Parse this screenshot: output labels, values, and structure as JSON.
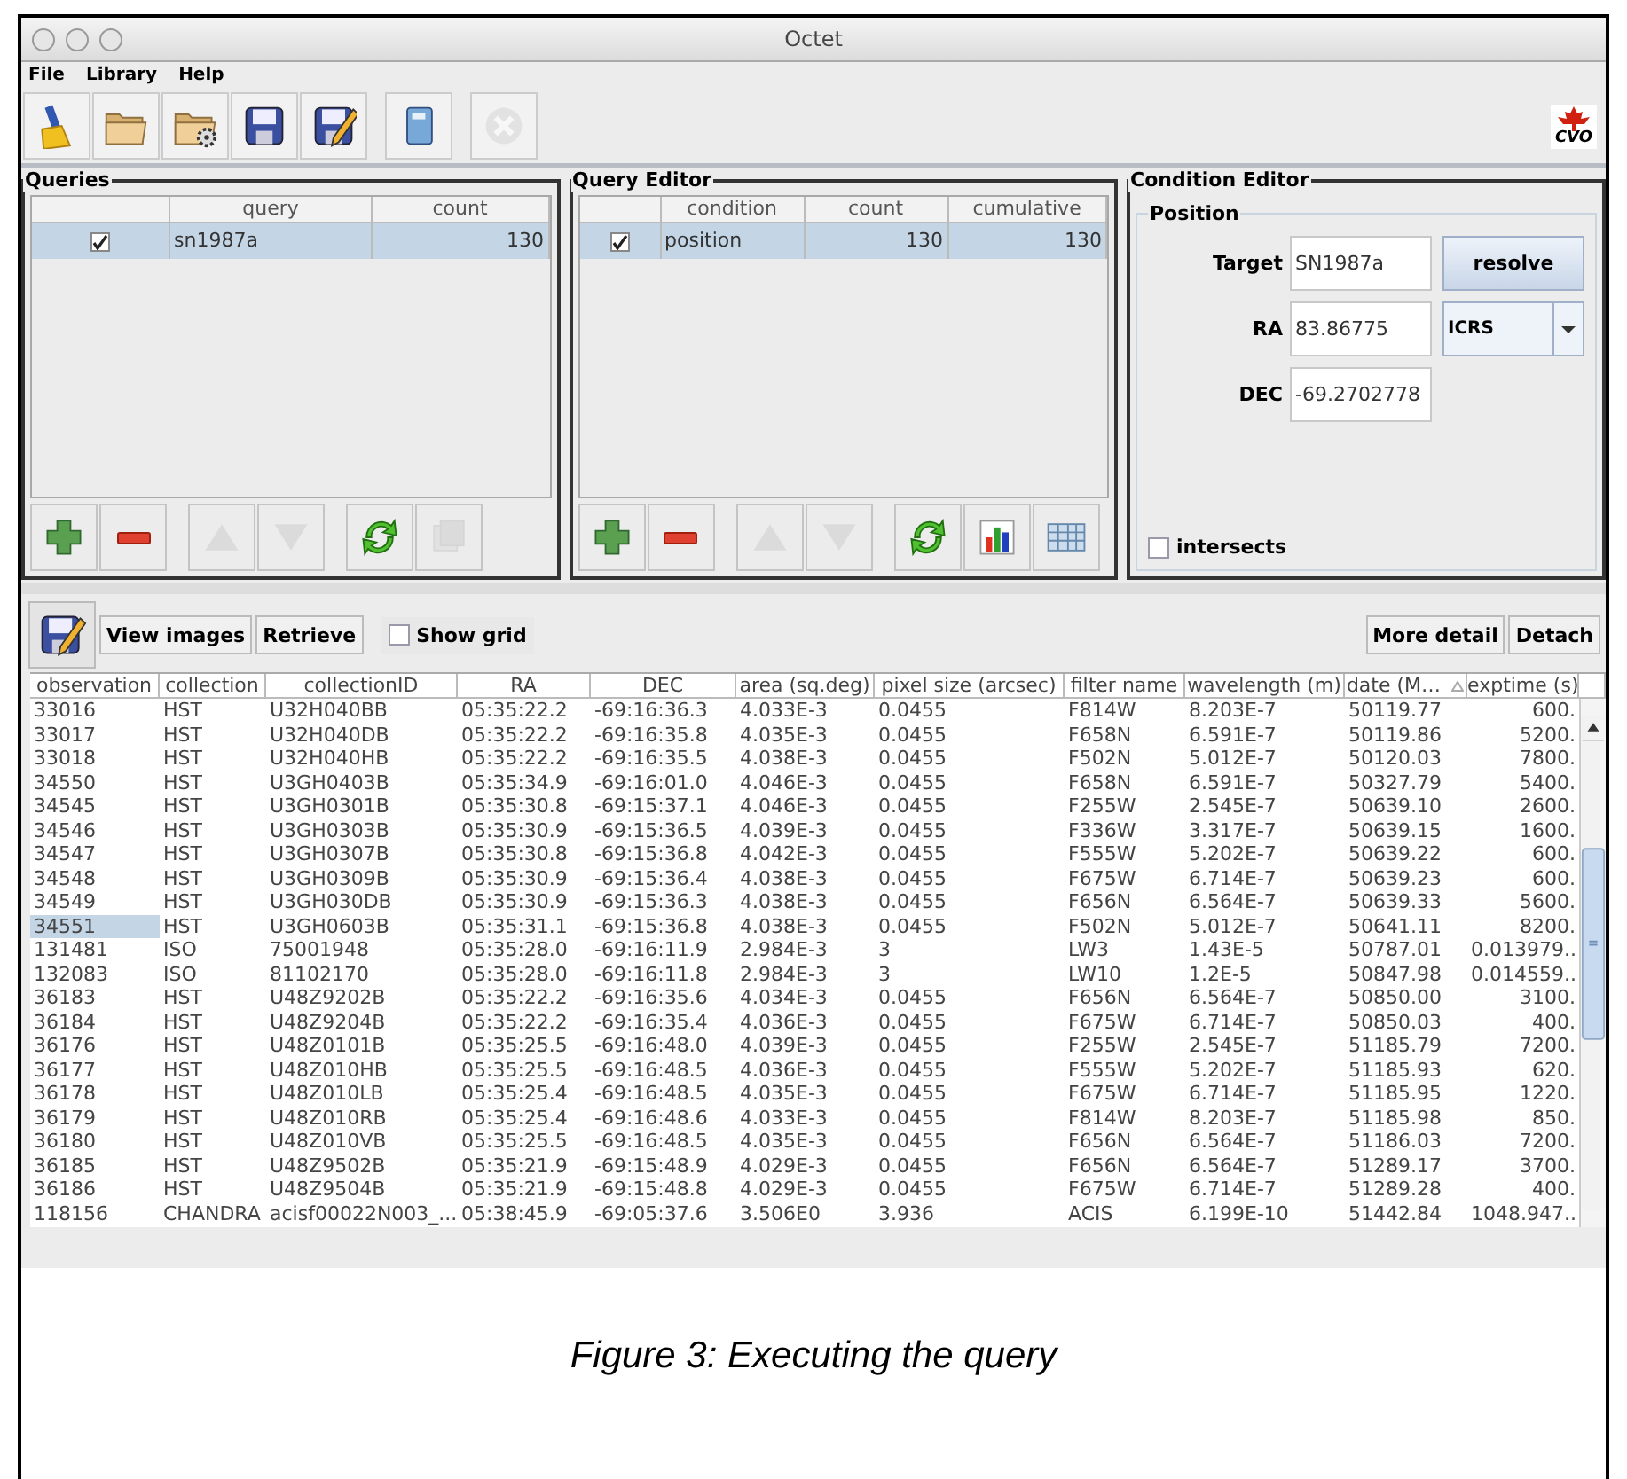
{
  "window": {
    "title": "Octet",
    "menu": [
      "File",
      "Library",
      "Help"
    ],
    "toolbar": [
      {
        "kind": "broom",
        "disabled": false
      },
      {
        "kind": "folder",
        "disabled": false
      },
      {
        "kind": "folder-gear",
        "disabled": false
      },
      {
        "kind": "floppy",
        "disabled": false
      },
      {
        "kind": "floppy-edit",
        "disabled": false
      },
      {
        "kind": "book",
        "disabled": false
      },
      {
        "kind": "cancel",
        "disabled": true
      }
    ],
    "logo_text": "CVO"
  },
  "queries": {
    "title": "Queries",
    "columns": [
      "",
      "query",
      "count"
    ],
    "rows": [
      {
        "checked": true,
        "query": "sn1987a",
        "count": "130",
        "selected": true
      }
    ],
    "buttons": [
      {
        "kind": "plus",
        "disabled": false
      },
      {
        "kind": "minus",
        "disabled": false
      },
      {
        "kind": "up",
        "disabled": true
      },
      {
        "kind": "down",
        "disabled": true
      },
      {
        "kind": "refresh",
        "disabled": false
      },
      {
        "kind": "copy",
        "disabled": true
      }
    ]
  },
  "query_editor": {
    "title": "Query Editor",
    "columns": [
      "",
      "condition",
      "count",
      "cumulative"
    ],
    "rows": [
      {
        "checked": true,
        "condition": "position",
        "count": "130",
        "cumulative": "130",
        "selected": true
      }
    ],
    "buttons": [
      {
        "kind": "plus",
        "disabled": false
      },
      {
        "kind": "minus",
        "disabled": false
      },
      {
        "kind": "up",
        "disabled": true
      },
      {
        "kind": "down",
        "disabled": true
      },
      {
        "kind": "refresh",
        "disabled": false
      },
      {
        "kind": "chart",
        "disabled": false
      },
      {
        "kind": "grid",
        "disabled": false
      }
    ]
  },
  "condition_editor": {
    "title": "Condition Editor",
    "group": "Position",
    "fields": [
      {
        "label": "Target",
        "value": "SN1987a"
      },
      {
        "label": "RA",
        "value": "83.86775"
      },
      {
        "label": "DEC",
        "value": "-69.2702778"
      }
    ],
    "resolve_button": "resolve",
    "frame": "ICRS",
    "intersects": {
      "label": "intersects",
      "checked": false
    }
  },
  "results": {
    "buttons": [
      "View images",
      "Retrieve"
    ],
    "show_grid": {
      "label": "Show grid",
      "checked": false
    },
    "right_buttons": [
      "More detail",
      "Detach"
    ],
    "columns": [
      "observation",
      "collection",
      "collectionID",
      "RA",
      "DEC",
      "area (sq.deg)",
      "pixel size (arcsec)",
      "filter name",
      "wavelength (m)",
      "date (M…",
      "exptime (s)"
    ],
    "rows": [
      {
        "selected": false,
        "cells": [
          "33016",
          "HST",
          "U32H040BB",
          "05:35:22.2",
          "-69:16:36.3",
          "4.033E-3",
          "0.0455",
          "F814W",
          "8.203E-7",
          "50119.77",
          "600."
        ]
      },
      {
        "selected": false,
        "cells": [
          "33017",
          "HST",
          "U32H040DB",
          "05:35:22.2",
          "-69:16:35.8",
          "4.035E-3",
          "0.0455",
          "F658N",
          "6.591E-7",
          "50119.86",
          "5200."
        ]
      },
      {
        "selected": false,
        "cells": [
          "33018",
          "HST",
          "U32H040HB",
          "05:35:22.2",
          "-69:16:35.5",
          "4.038E-3",
          "0.0455",
          "F502N",
          "5.012E-7",
          "50120.03",
          "7800."
        ]
      },
      {
        "selected": false,
        "cells": [
          "34550",
          "HST",
          "U3GH0403B",
          "05:35:34.9",
          "-69:16:01.0",
          "4.046E-3",
          "0.0455",
          "F658N",
          "6.591E-7",
          "50327.79",
          "5400."
        ]
      },
      {
        "selected": false,
        "cells": [
          "34545",
          "HST",
          "U3GH0301B",
          "05:35:30.8",
          "-69:15:37.1",
          "4.046E-3",
          "0.0455",
          "F255W",
          "2.545E-7",
          "50639.10",
          "2600."
        ]
      },
      {
        "selected": false,
        "cells": [
          "34546",
          "HST",
          "U3GH0303B",
          "05:35:30.9",
          "-69:15:36.5",
          "4.039E-3",
          "0.0455",
          "F336W",
          "3.317E-7",
          "50639.15",
          "1600."
        ]
      },
      {
        "selected": false,
        "cells": [
          "34547",
          "HST",
          "U3GH0307B",
          "05:35:30.8",
          "-69:15:36.8",
          "4.042E-3",
          "0.0455",
          "F555W",
          "5.202E-7",
          "50639.22",
          "600."
        ]
      },
      {
        "selected": false,
        "cells": [
          "34548",
          "HST",
          "U3GH0309B",
          "05:35:30.9",
          "-69:15:36.4",
          "4.038E-3",
          "0.0455",
          "F675W",
          "6.714E-7",
          "50639.23",
          "600."
        ]
      },
      {
        "selected": false,
        "cells": [
          "34549",
          "HST",
          "U3GH030DB",
          "05:35:30.9",
          "-69:15:36.3",
          "4.038E-3",
          "0.0455",
          "F656N",
          "6.564E-7",
          "50639.33",
          "5600."
        ]
      },
      {
        "selected": true,
        "cells": [
          "34551",
          "HST",
          "U3GH0603B",
          "05:35:31.1",
          "-69:15:36.8",
          "4.038E-3",
          "0.0455",
          "F502N",
          "5.012E-7",
          "50641.11",
          "8200."
        ]
      },
      {
        "selected": false,
        "cells": [
          "131481",
          "ISO",
          "75001948",
          "05:35:28.0",
          "-69:16:11.9",
          "2.984E-3",
          "3",
          "LW3",
          "1.43E-5",
          "50787.01",
          "0.013979.."
        ]
      },
      {
        "selected": false,
        "cells": [
          "132083",
          "ISO",
          "81102170",
          "05:35:28.0",
          "-69:16:11.8",
          "2.984E-3",
          "3",
          "LW10",
          "1.2E-5",
          "50847.98",
          "0.014559.."
        ]
      },
      {
        "selected": false,
        "cells": [
          "36183",
          "HST",
          "U48Z9202B",
          "05:35:22.2",
          "-69:16:35.6",
          "4.034E-3",
          "0.0455",
          "F656N",
          "6.564E-7",
          "50850.00",
          "3100."
        ]
      },
      {
        "selected": false,
        "cells": [
          "36184",
          "HST",
          "U48Z9204B",
          "05:35:22.2",
          "-69:16:35.4",
          "4.036E-3",
          "0.0455",
          "F675W",
          "6.714E-7",
          "50850.03",
          "400."
        ]
      },
      {
        "selected": false,
        "cells": [
          "36176",
          "HST",
          "U48Z0101B",
          "05:35:25.5",
          "-69:16:48.0",
          "4.039E-3",
          "0.0455",
          "F255W",
          "2.545E-7",
          "51185.79",
          "7200."
        ]
      },
      {
        "selected": false,
        "cells": [
          "36177",
          "HST",
          "U48Z010HB",
          "05:35:25.5",
          "-69:16:48.5",
          "4.036E-3",
          "0.0455",
          "F555W",
          "5.202E-7",
          "51185.93",
          "620."
        ]
      },
      {
        "selected": false,
        "cells": [
          "36178",
          "HST",
          "U48Z010LB",
          "05:35:25.4",
          "-69:16:48.5",
          "4.035E-3",
          "0.0455",
          "F675W",
          "6.714E-7",
          "51185.95",
          "1220."
        ]
      },
      {
        "selected": false,
        "cells": [
          "36179",
          "HST",
          "U48Z010RB",
          "05:35:25.4",
          "-69:16:48.6",
          "4.033E-3",
          "0.0455",
          "F814W",
          "8.203E-7",
          "51185.98",
          "850."
        ]
      },
      {
        "selected": false,
        "cells": [
          "36180",
          "HST",
          "U48Z010VB",
          "05:35:25.5",
          "-69:16:48.5",
          "4.035E-3",
          "0.0455",
          "F656N",
          "6.564E-7",
          "51186.03",
          "7200."
        ]
      },
      {
        "selected": false,
        "cells": [
          "36185",
          "HST",
          "U48Z9502B",
          "05:35:21.9",
          "-69:15:48.9",
          "4.029E-3",
          "0.0455",
          "F656N",
          "6.564E-7",
          "51289.17",
          "3700."
        ]
      },
      {
        "selected": false,
        "cells": [
          "36186",
          "HST",
          "U48Z9504B",
          "05:35:21.9",
          "-69:15:48.8",
          "4.029E-3",
          "0.0455",
          "F675W",
          "6.714E-7",
          "51289.28",
          "400."
        ]
      },
      {
        "selected": false,
        "cells": [
          "118156",
          "CHANDRA",
          "acisf00022N003_...",
          "05:38:45.9",
          "-69:05:37.6",
          "3.506E0",
          "3.936",
          "ACIS",
          "6.199E-10",
          "51442.84",
          "1048.947.."
        ]
      }
    ]
  },
  "caption": "Figure 3: Executing the query"
}
